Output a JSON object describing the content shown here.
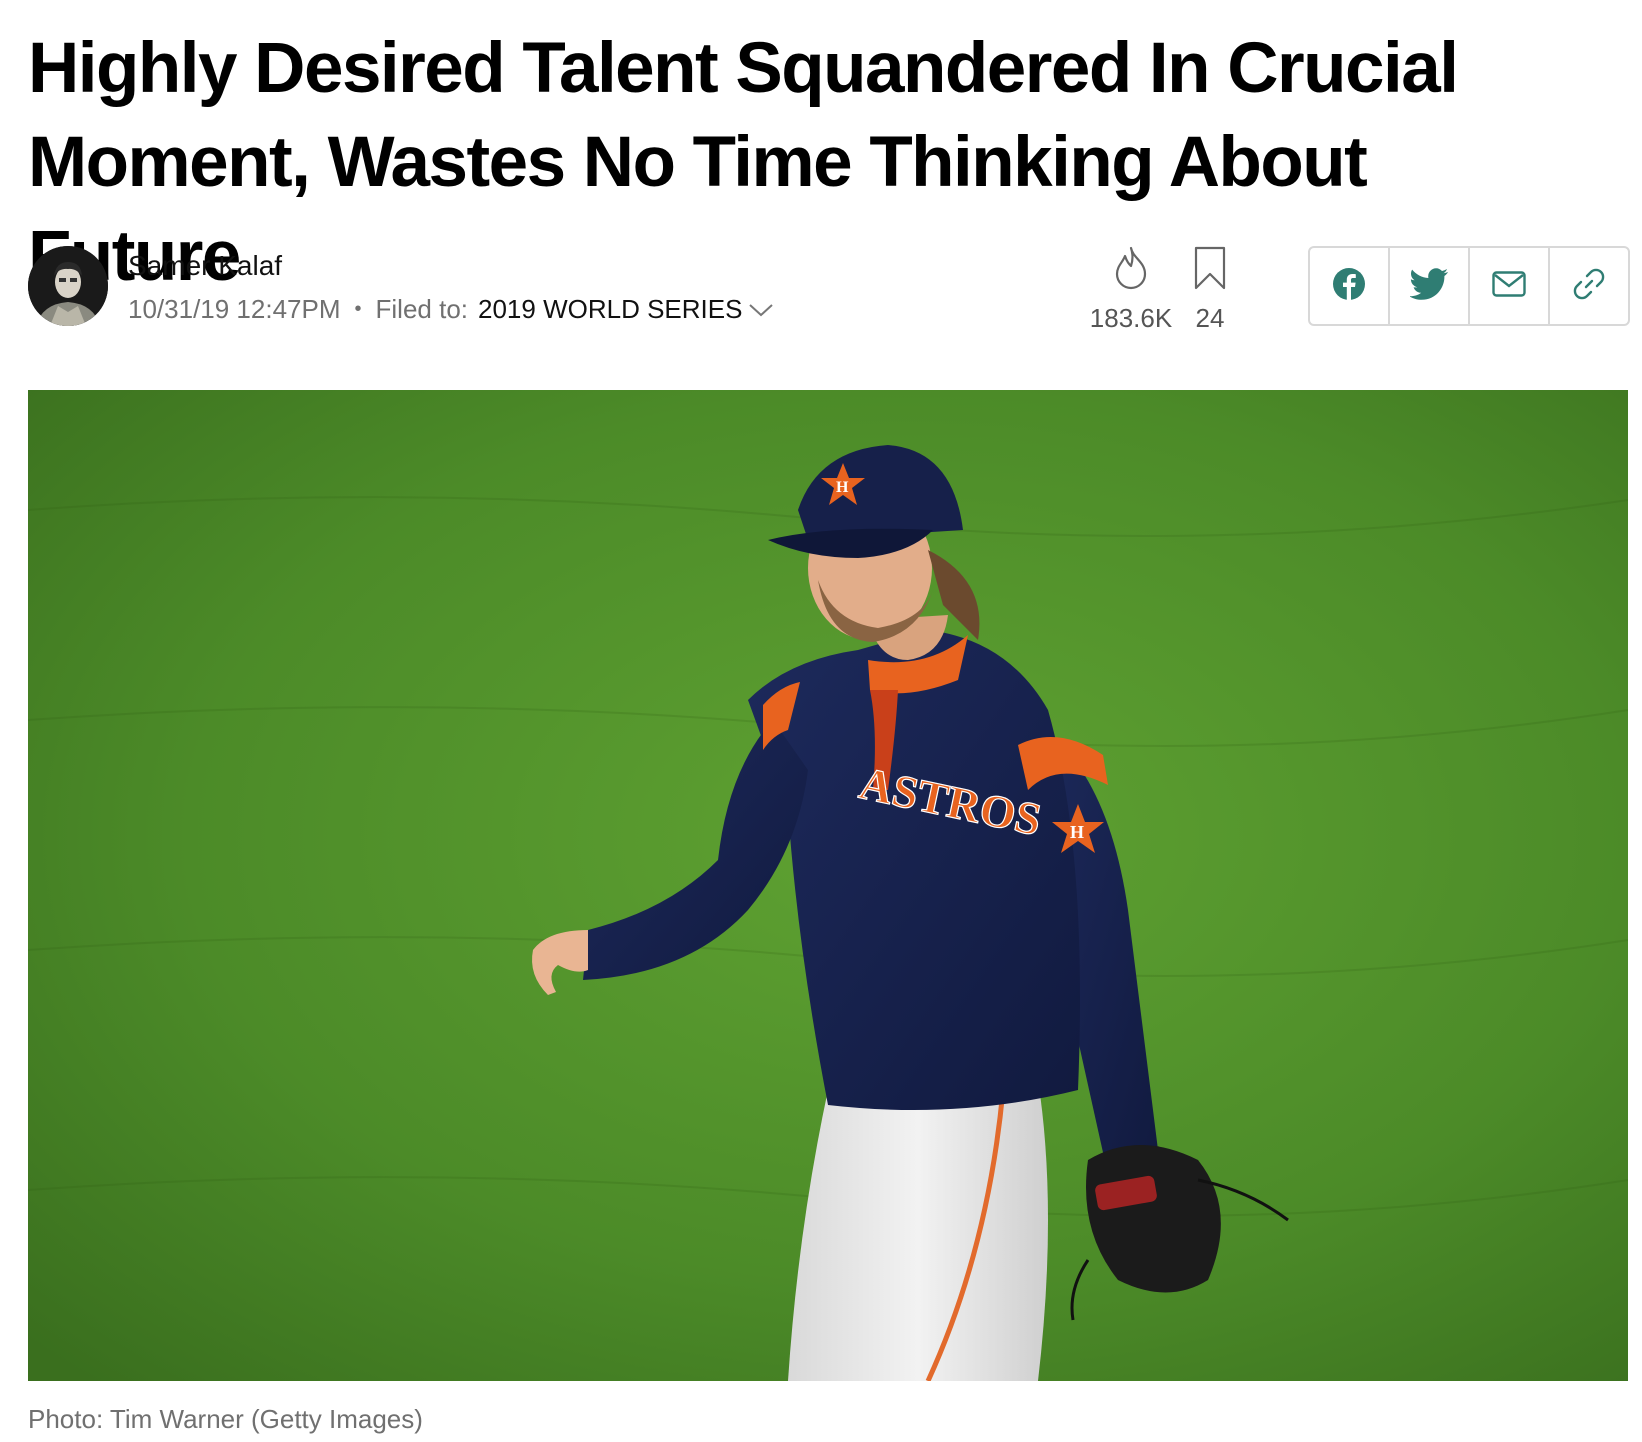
{
  "article": {
    "title": "Highly Desired Talent Squandered In Crucial Moment, Wastes No Time Thinking About Future",
    "author": "Samer Kalaf",
    "timestamp": "10/31/19 12:47PM",
    "separator": "•",
    "filed_label": "Filed to:",
    "filed_value": "2019 WORLD SERIES",
    "filed_icon": "chevron-down-icon"
  },
  "stats": {
    "views": {
      "icon": "flame-icon",
      "value": "183.6K"
    },
    "bookmarks": {
      "icon": "bookmark-icon",
      "value": "24"
    }
  },
  "share": {
    "buttons": [
      {
        "icon": "facebook-icon"
      },
      {
        "icon": "twitter-icon"
      },
      {
        "icon": "email-icon"
      },
      {
        "icon": "link-icon"
      }
    ],
    "accent_color": "#2f7d73"
  },
  "hero": {
    "jersey_text": "ASTROS",
    "cap_letter": "H",
    "caption": "Photo: Tim Warner (Getty Images)"
  }
}
